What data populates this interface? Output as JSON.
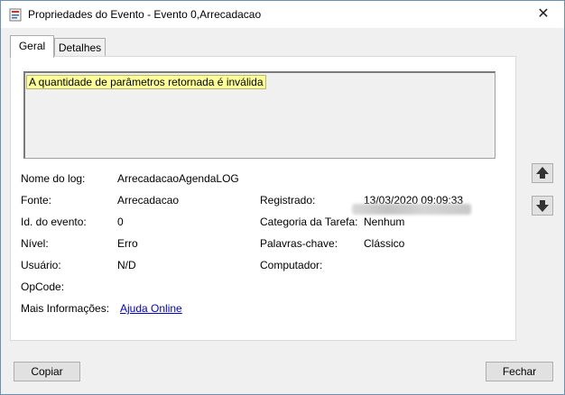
{
  "window": {
    "title": "Propriedades do Evento - Evento 0,Arrecadacao",
    "close_glyph": "✕"
  },
  "tabs": [
    {
      "label": "Geral",
      "active": true
    },
    {
      "label": "Detalhes",
      "active": false
    }
  ],
  "general": {
    "description": "A quantidade de parâmetros retornada é inválida",
    "fields": {
      "log_name": {
        "label": "Nome do log:",
        "value": "ArrecadacaoAgendaLOG"
      },
      "source": {
        "label": "Fonte:",
        "value": "Arrecadacao"
      },
      "logged": {
        "label": "Registrado:",
        "value": "13/03/2020 09:09:33"
      },
      "event_id": {
        "label": "Id. do evento:",
        "value": "0"
      },
      "task_category": {
        "label": "Categoria da Tarefa:",
        "value": "Nenhum"
      },
      "level": {
        "label": "Nível:",
        "value": "Erro"
      },
      "keywords": {
        "label": "Palavras-chave:",
        "value": "Clássico"
      },
      "user": {
        "label": "Usuário:",
        "value": "N/D"
      },
      "computer": {
        "label": "Computador:"
      },
      "opcode": {
        "label": "OpCode:"
      },
      "more_info": {
        "label": "Mais Informações:",
        "link": "Ajuda Online"
      }
    }
  },
  "buttons": {
    "copy": "Copiar",
    "close": "Fechar"
  },
  "colors": {
    "highlight": "#ffff99",
    "link": "#0000cc"
  }
}
